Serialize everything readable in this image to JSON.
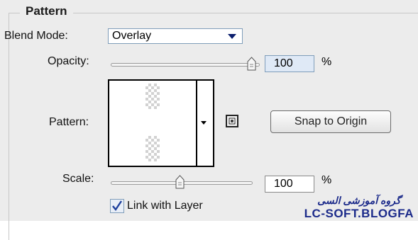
{
  "section_title": "Pattern",
  "blend_mode": {
    "label": "Blend Mode:",
    "value": "Overlay"
  },
  "opacity": {
    "label": "Opacity:",
    "value": "100",
    "unit": "%",
    "level": 1.0
  },
  "pattern": {
    "label": "Pattern:"
  },
  "snap_button": {
    "label": "Snap to Origin"
  },
  "scale": {
    "label": "Scale:",
    "value": "100",
    "unit": "%",
    "level": 0.5
  },
  "link_layer": {
    "label": "Link with Layer",
    "checked": true
  },
  "watermark": {
    "line1": "گروه آموزشی السی",
    "line2": "LC-SOFT.BLOGFA"
  },
  "colors": {
    "panel": "#ececec",
    "watermark": "#1b2a8a",
    "focus_input": "#dfe9f6"
  }
}
